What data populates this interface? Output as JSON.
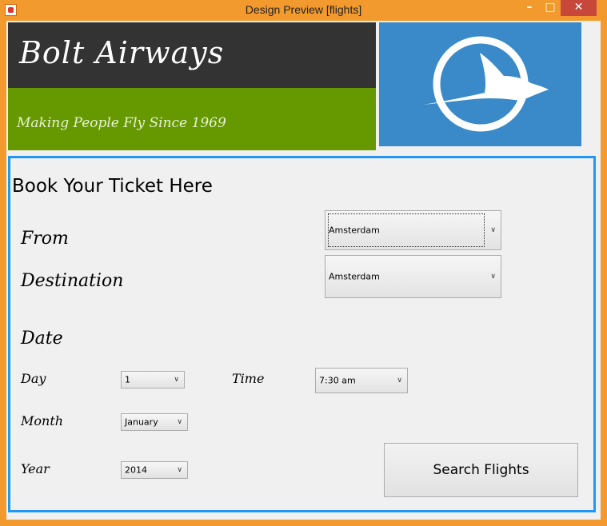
{
  "window": {
    "title": "Design Preview [flights]",
    "minimize": "–",
    "maximize": "□",
    "close": "✕"
  },
  "banner": {
    "brand": "Bolt Airways",
    "tagline": "Making People Fly Since 1969",
    "logo_icon": "swallow-bird-icon"
  },
  "colors": {
    "titlebar": "#f39a2e",
    "banner_dark": "#333333",
    "banner_green": "#669900",
    "logo_bg": "#3a8ac9",
    "panel_border": "#2196f3"
  },
  "form": {
    "heading": "Book Your Ticket Here",
    "from_label": "From",
    "from_value": "Amsterdam",
    "destination_label": "Destination",
    "destination_value": "Amsterdam",
    "date_label": "Date",
    "day_label": "Day",
    "day_value": "1",
    "time_label": "Time",
    "time_value": "7:30 am",
    "month_label": "Month",
    "month_value": "January",
    "year_label": "Year",
    "year_value": "2014",
    "search_button": "Search Flights"
  }
}
